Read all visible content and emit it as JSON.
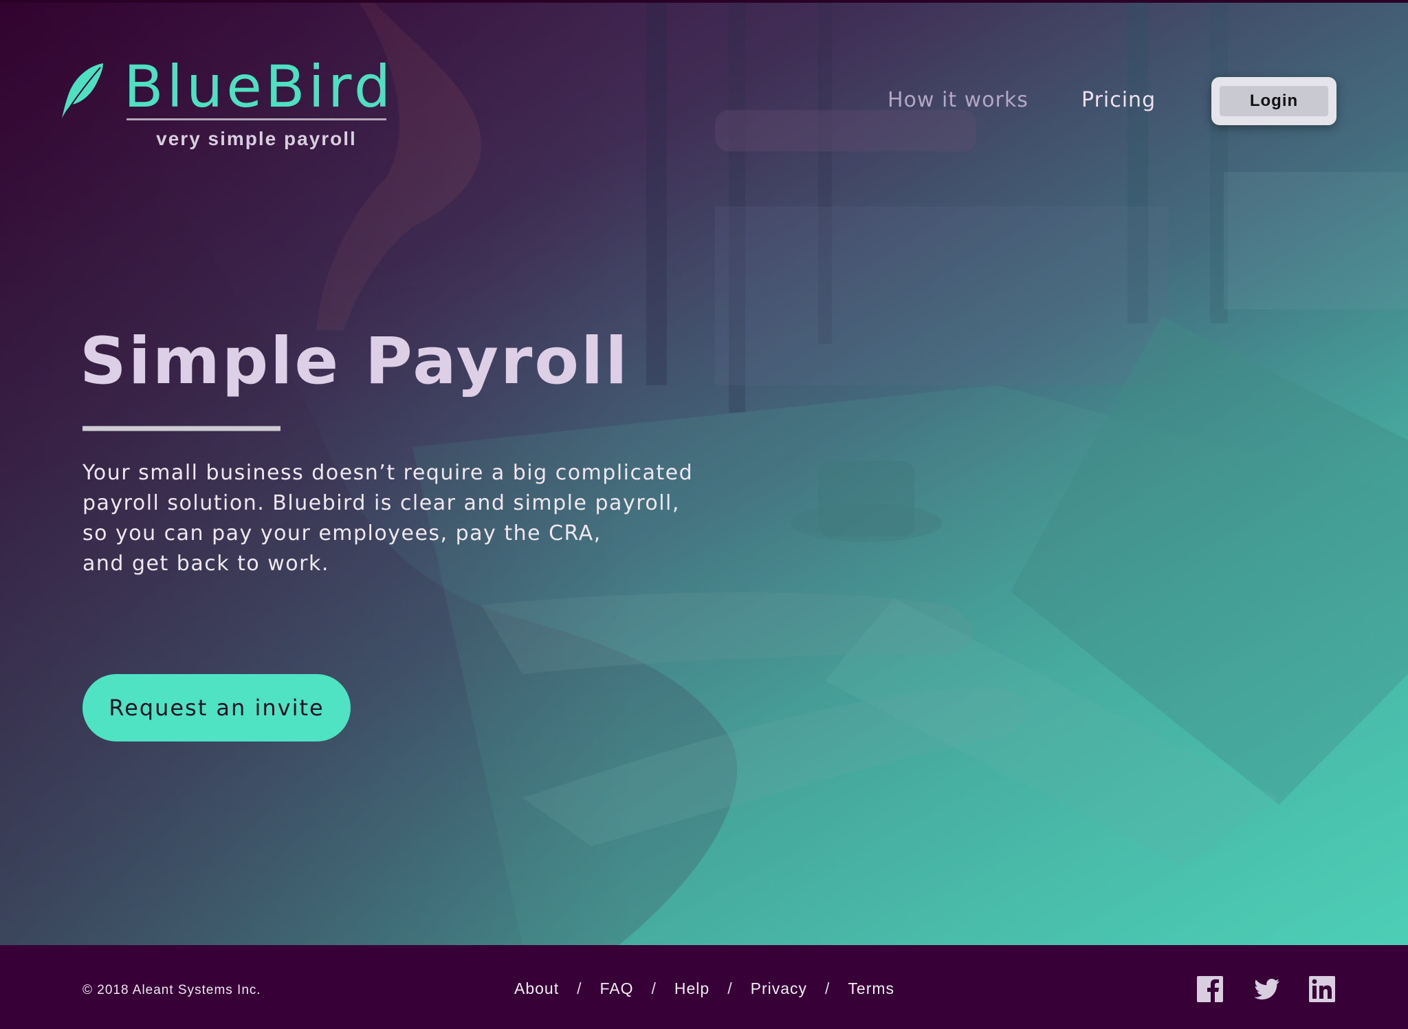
{
  "brand": {
    "name": "BlueBird",
    "tagline": "very simple payroll",
    "icon": "feather-icon",
    "color": "#4fe0c2"
  },
  "nav": {
    "items": [
      {
        "label": "How it works"
      },
      {
        "label": "Pricing"
      }
    ],
    "login_label": "Login"
  },
  "hero": {
    "title": "Simple Payroll",
    "body_lines": [
      "Your small business doesn’t require a big complicated",
      "payroll solution. Bluebird is clear and simple payroll,",
      "so you can pay your employees, pay the CRA,",
      "and get back to work."
    ],
    "cta_label": "Request an invite",
    "cta_color": "#4fe3c3"
  },
  "footer": {
    "copyright": "© 2018 Aleant Systems Inc.",
    "links": [
      "About",
      "FAQ",
      "Help",
      "Privacy",
      "Terms"
    ],
    "separator": "/",
    "social": [
      "facebook-icon",
      "twitter-icon",
      "linkedin-icon"
    ],
    "background": "#370036"
  }
}
